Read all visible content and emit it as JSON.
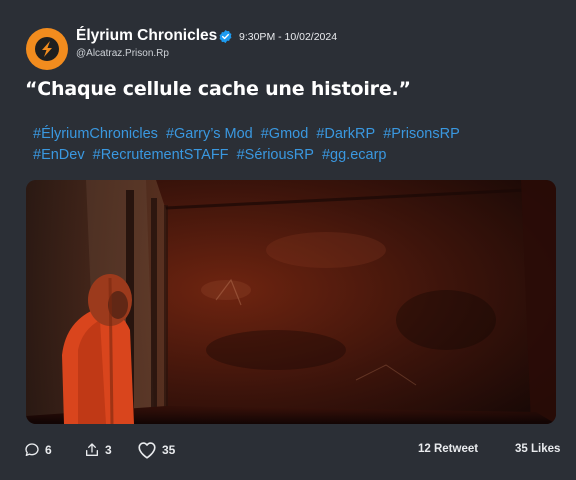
{
  "post": {
    "author_name": "Élyrium Chronicles",
    "author_handle": "@Alcatraz.Prison.Rp",
    "timestamp": "9:30PM - 10/02/2024",
    "text": "“Chaque cellule cache une histoire.”",
    "hashtags": [
      "#ÉlyriumChronicles",
      "#Garry’s Mod",
      "#Gmod",
      "#DarkRP",
      "#PrisonsRP",
      "#EnDev",
      "#RecrutementSTAFF",
      "#SériousRP",
      "#gg.ecarp"
    ],
    "media": {
      "description_icon": "prison-cell-image"
    }
  },
  "actions": {
    "comments": "6",
    "shares": "3",
    "likes": "35"
  },
  "stats": {
    "retweets": "12 Retweet",
    "likes": "35 Likes"
  },
  "colors": {
    "background": "#2b2f36",
    "accent": "#3a98e0",
    "avatar": "#f28c1e"
  }
}
